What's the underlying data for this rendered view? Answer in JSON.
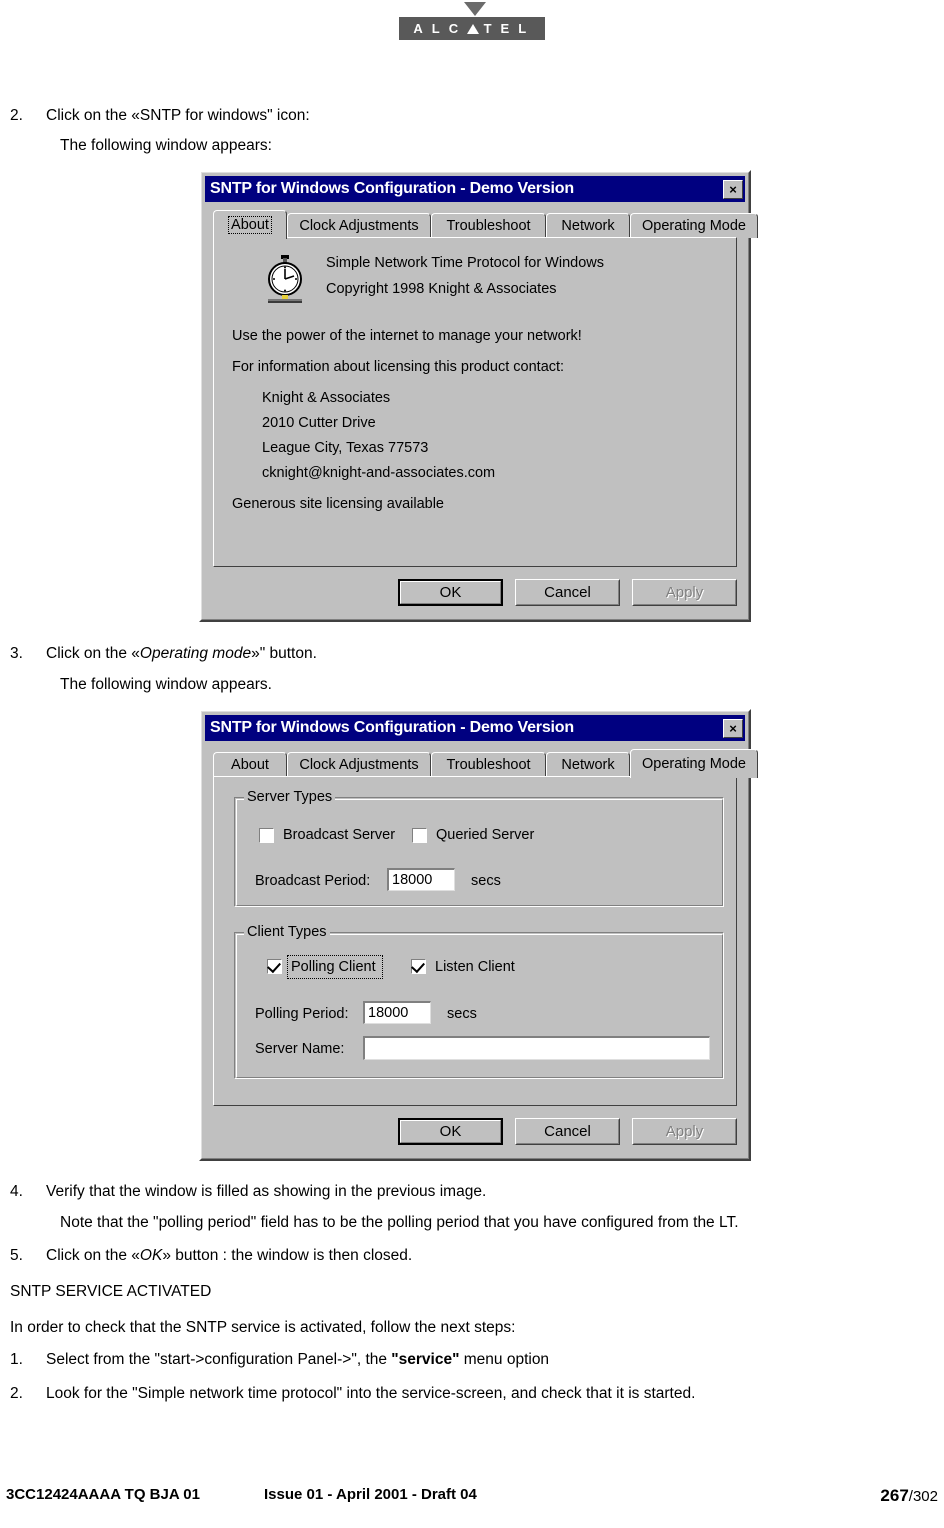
{
  "brand": {
    "name": "ALCATEL",
    "letters": [
      "A",
      "L",
      "C",
      "A",
      "T",
      "E",
      "L"
    ]
  },
  "steps": {
    "step2": {
      "num": "2.",
      "text_a": "Click on the «SNTP for windows\" icon:",
      "sub": "The following window appears:"
    },
    "step3": {
      "num": "3.",
      "pre": "Click on the «",
      "em": "Operating mode",
      "post": "»\" button.",
      "sub": "The following window appears."
    },
    "step4": {
      "num": "4.",
      "text": "Verify that the window is filled as showing in the previous image.",
      "note": "Note that the \"polling period\" field has to be the polling period that you have configured from the LT."
    },
    "step5": {
      "num": "5.",
      "pre": "Click on the «",
      "em": "OK",
      "post": "» button : the window is then closed."
    },
    "heading": "SNTP SERVICE ACTIVATED",
    "intro": "In order to check that the SNTP service is activated, follow the next steps:",
    "check1": {
      "num": "1.",
      "pre": "Select from the \"start->configuration Panel->\", the ",
      "em": "\"service\"",
      "post": " menu option"
    },
    "check2": {
      "num": "2.",
      "text": "Look for the \"Simple network time protocol\" into the service-screen, and check that it is started."
    }
  },
  "dialog1": {
    "title": "SNTP for Windows Configuration - Demo Version",
    "close_label": "×",
    "tabs": [
      {
        "label": "About",
        "active": true
      },
      {
        "label": "Clock Adjustments",
        "active": false
      },
      {
        "label": "Troubleshoot",
        "active": false
      },
      {
        "label": "Network",
        "active": false
      },
      {
        "label": "Operating Mode",
        "active": false
      }
    ],
    "about": {
      "product": "Simple Network Time Protocol for Windows",
      "copyright": "Copyright 1998 Knight & Associates",
      "tagline": "Use the power of the internet to manage your network!",
      "contact_intro": "For information about licensing this product contact:",
      "address": [
        "Knight & Associates",
        "2010 Cutter Drive",
        "League City, Texas 77573",
        "cknight@knight-and-associates.com"
      ],
      "licensing": "Generous site licensing available"
    },
    "buttons": [
      {
        "label": "OK",
        "state": "default"
      },
      {
        "label": "Cancel",
        "state": "normal"
      },
      {
        "label": "Apply",
        "state": "disabled"
      }
    ]
  },
  "dialog2": {
    "title": "SNTP for Windows Configuration - Demo Version",
    "close_label": "×",
    "tabs": [
      {
        "label": "About",
        "active": false
      },
      {
        "label": "Clock Adjustments",
        "active": false
      },
      {
        "label": "Troubleshoot",
        "active": false
      },
      {
        "label": "Network",
        "active": false
      },
      {
        "label": "Operating Mode",
        "active": true
      }
    ],
    "server_types": {
      "group_title": "Server Types",
      "broadcast_server": {
        "label": "Broadcast Server",
        "checked": false
      },
      "queried_server": {
        "label": "Queried Server",
        "checked": false
      },
      "broadcast_period": {
        "label": "Broadcast Period:",
        "value": "18000",
        "unit": "secs"
      }
    },
    "client_types": {
      "group_title": "Client Types",
      "polling_client": {
        "label": "Polling Client",
        "checked": true,
        "focused": true
      },
      "listen_client": {
        "label": "Listen Client",
        "checked": true
      },
      "polling_period": {
        "label": "Polling Period:",
        "value": "18000",
        "unit": "secs"
      },
      "server_name": {
        "label": "Server Name:",
        "value": ""
      }
    },
    "buttons": [
      {
        "label": "OK",
        "state": "default"
      },
      {
        "label": "Cancel",
        "state": "normal"
      },
      {
        "label": "Apply",
        "state": "disabled"
      }
    ]
  },
  "footer": {
    "left": "3CC12424AAAA TQ BJA 01",
    "middle": "Issue 01 - April 2001 - Draft 04",
    "page": "267",
    "total": "/302"
  },
  "colors": {
    "titlebar": "#000080",
    "dialog_face": "#c0c0c0",
    "logo": "#595959"
  }
}
